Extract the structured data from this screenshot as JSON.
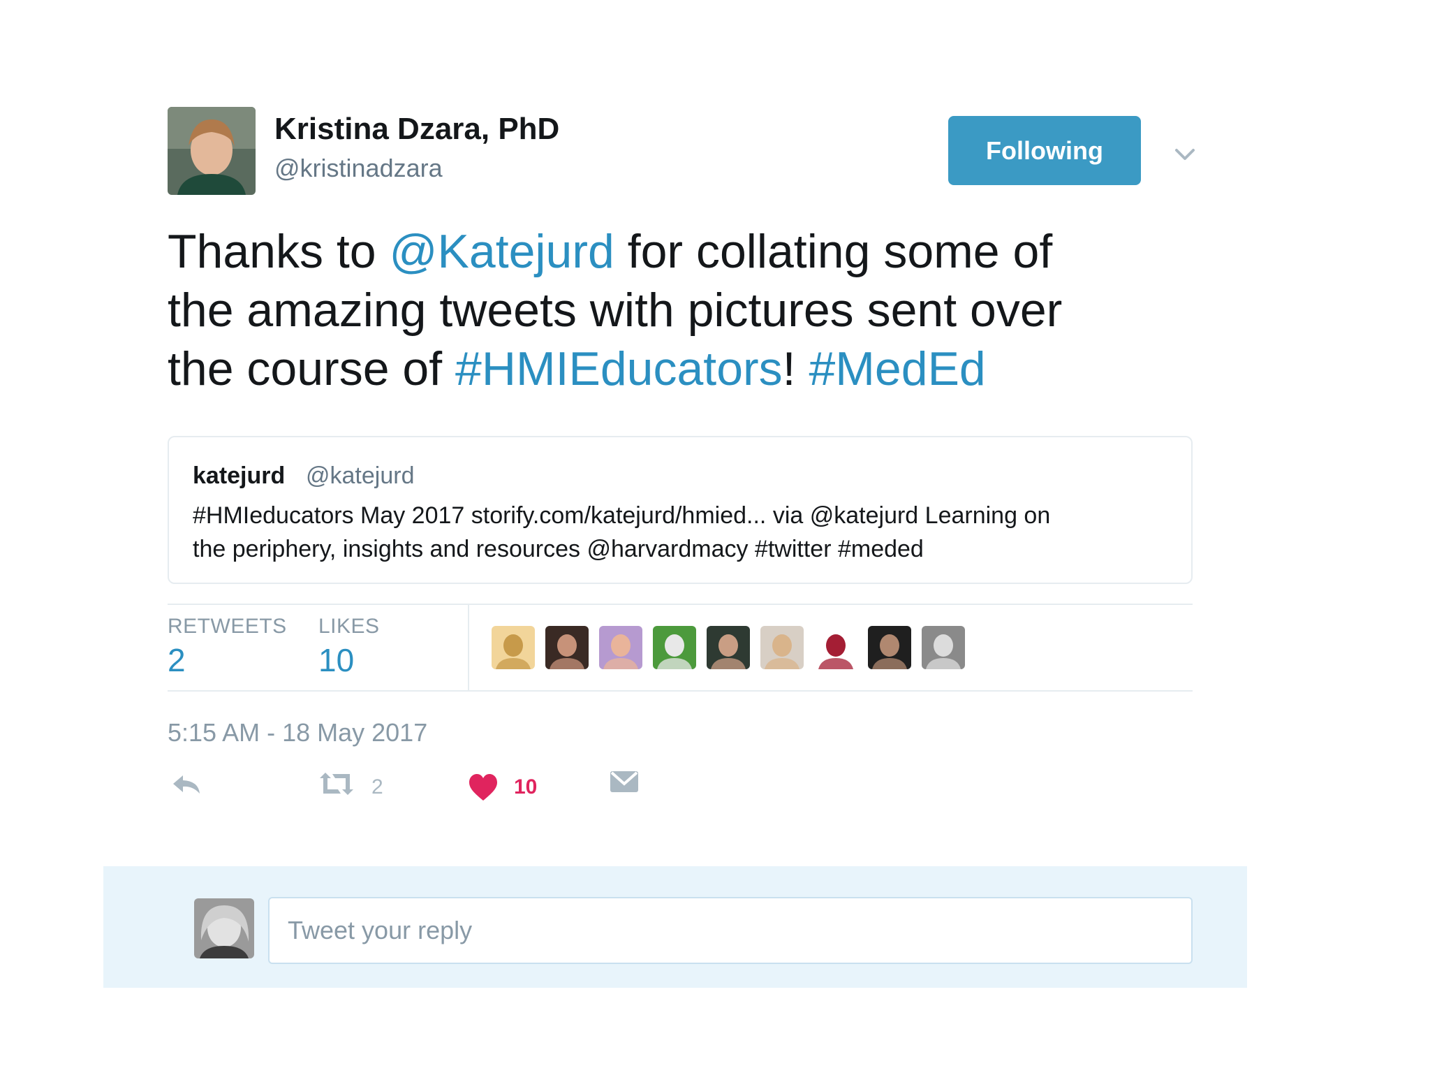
{
  "author": {
    "name": "Kristina Dzara, PhD",
    "handle": "@kristinadzara"
  },
  "follow_button": {
    "label": "Following"
  },
  "tweet": {
    "lines": [
      [
        {
          "t": "Thanks to ",
          "link": false
        },
        {
          "t": "@Katejurd",
          "link": true
        },
        {
          "t": " for collating some of",
          "link": false
        }
      ],
      [
        {
          "t": "the amazing tweets with pictures sent over",
          "link": false
        }
      ],
      [
        {
          "t": "the course of ",
          "link": false
        },
        {
          "t": "#HMIEducators",
          "link": true
        },
        {
          "t": "! ",
          "link": false
        },
        {
          "t": "#MedEd",
          "link": true
        }
      ]
    ]
  },
  "quoted_tweet": {
    "name": "katejurd",
    "handle": "@katejurd",
    "line1": "#HMIeducators May 2017 storify.com/katejurd/hmied... via @katejurd Learning on",
    "line2": "the periphery, insights and resources @harvardmacy #twitter #meded"
  },
  "stats": {
    "retweets_label": "RETWEETS",
    "retweets_value": "2",
    "likes_label": "LIKES",
    "likes_value": "10"
  },
  "likers": [
    {
      "name": "liker-avatar-1",
      "bg": "#f2d59a",
      "fg": "#c79a4a"
    },
    {
      "name": "liker-avatar-2",
      "bg": "#3a2a24",
      "fg": "#c79279"
    },
    {
      "name": "liker-avatar-3",
      "bg": "#b69ad0",
      "fg": "#e9b49a"
    },
    {
      "name": "liker-avatar-4",
      "bg": "#4c9a3c",
      "fg": "#e8e8e8"
    },
    {
      "name": "liker-avatar-5",
      "bg": "#2e3a32",
      "fg": "#c99e84"
    },
    {
      "name": "liker-avatar-6",
      "bg": "#d8cfc5",
      "fg": "#d9b48b"
    },
    {
      "name": "liker-avatar-7",
      "bg": "#ffffff",
      "fg": "#a41e34"
    },
    {
      "name": "liker-avatar-8",
      "bg": "#1f1f1f",
      "fg": "#b08870"
    },
    {
      "name": "liker-avatar-9",
      "bg": "#8a8a8a",
      "fg": "#dcdcdc"
    }
  ],
  "timestamp": "5:15 AM - 18 May 2017",
  "actions": {
    "retweet_count": "2",
    "like_count": "10"
  },
  "reply": {
    "placeholder": "Tweet your reply"
  },
  "colors": {
    "link": "#2b8fc1",
    "follow_button": "#3b9ac4",
    "like_heart": "#e0245e",
    "reply_bar": "#e8f4fb"
  },
  "icons": [
    "chevron-down-icon",
    "reply-icon",
    "retweet-icon",
    "heart-icon",
    "direct-message-icon"
  ]
}
